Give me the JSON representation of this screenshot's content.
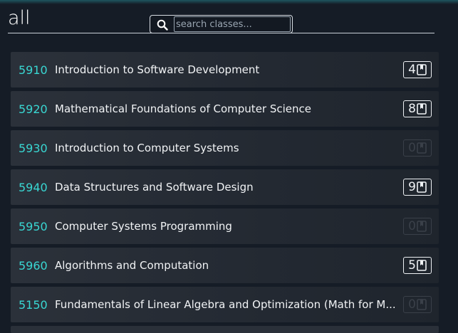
{
  "header": {
    "title": "all"
  },
  "search": {
    "placeholder": "search classes..."
  },
  "classes": [
    {
      "number": "5910",
      "name": "Introduction to Software Development",
      "count": "4"
    },
    {
      "number": "5920",
      "name": "Mathematical Foundations of Computer Science",
      "count": "8"
    },
    {
      "number": "5930",
      "name": "Introduction to Computer Systems",
      "count": "0"
    },
    {
      "number": "5940",
      "name": "Data Structures and Software Design",
      "count": "9"
    },
    {
      "number": "5950",
      "name": "Computer Systems Programming",
      "count": "0"
    },
    {
      "number": "5960",
      "name": "Algorithms and Computation",
      "count": "5"
    },
    {
      "number": "5150",
      "name": "Fundamentals of Linear Algebra and Optimization (Math for M...",
      "count": "0"
    }
  ],
  "icons": {
    "search": "search-icon",
    "review": "book-icon"
  },
  "colors": {
    "background": "#151c26",
    "class_number": "#39d7d3",
    "badge_active": "#eef1f4",
    "badge_inactive": "#3a4049"
  }
}
